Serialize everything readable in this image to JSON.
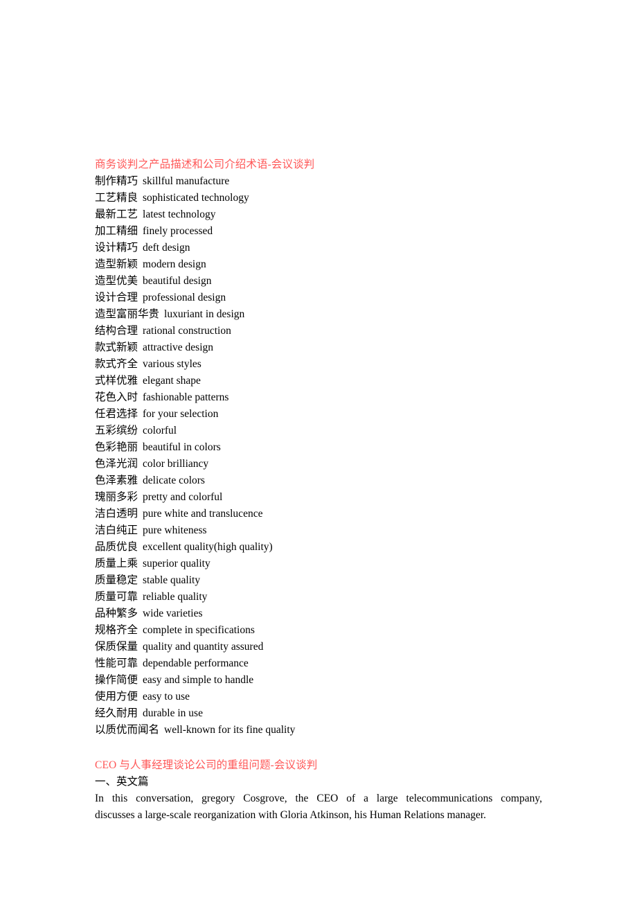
{
  "document": {
    "page_background": "#ffffff",
    "text_color": "#000000",
    "heading_color": "#ff5757"
  },
  "section1": {
    "title": "商务谈判之产品描述和公司介绍术语-会议谈判",
    "entries": [
      {
        "zh": "制作精巧",
        "en": "skillful manufacture"
      },
      {
        "zh": "工艺精良",
        "en": "sophisticated technology"
      },
      {
        "zh": "最新工艺",
        "en": "latest technology"
      },
      {
        "zh": "加工精细",
        "en": "finely processed"
      },
      {
        "zh": "设计精巧",
        "en": "deft design"
      },
      {
        "zh": "造型新颖",
        "en": "modern design"
      },
      {
        "zh": "造型优美",
        "en": "beautiful design"
      },
      {
        "zh": "设计合理",
        "en": "professional design"
      },
      {
        "zh": "造型富丽华贵",
        "en": "luxuriant in design"
      },
      {
        "zh": "结构合理",
        "en": "rational construction"
      },
      {
        "zh": "款式新颖",
        "en": "attractive design"
      },
      {
        "zh": "款式齐全",
        "en": "various styles"
      },
      {
        "zh": "式样优雅",
        "en": "elegant shape"
      },
      {
        "zh": "花色入时",
        "en": "fashionable patterns"
      },
      {
        "zh": "任君选择",
        "en": "for your selection"
      },
      {
        "zh": "五彩缤纷",
        "en": "colorful"
      },
      {
        "zh": "色彩艳丽",
        "en": "beautiful in colors"
      },
      {
        "zh": "色泽光润",
        "en": "color brilliancy"
      },
      {
        "zh": "色泽素雅",
        "en": "delicate colors"
      },
      {
        "zh": "瑰丽多彩",
        "en": "pretty and colorful"
      },
      {
        "zh": "洁白透明",
        "en": "pure white and translucence"
      },
      {
        "zh": "洁白纯正",
        "en": "pure whiteness"
      },
      {
        "zh": "品质优良",
        "en": "excellent quality(high quality)"
      },
      {
        "zh": "质量上乘",
        "en": "superior quality"
      },
      {
        "zh": "质量稳定",
        "en": "stable quality"
      },
      {
        "zh": "质量可靠",
        "en": "reliable quality"
      },
      {
        "zh": "品种繁多",
        "en": "wide varieties"
      },
      {
        "zh": "规格齐全",
        "en": "complete in specifications"
      },
      {
        "zh": "保质保量",
        "en": "quality and quantity assured"
      },
      {
        "zh": "性能可靠",
        "en": "dependable performance"
      },
      {
        "zh": "操作简便",
        "en": "easy and simple to handle"
      },
      {
        "zh": "使用方便",
        "en": "easy to use"
      },
      {
        "zh": "经久耐用",
        "en": "durable in use"
      },
      {
        "zh": "以质优而闻名",
        "en": "well-known for its fine quality"
      }
    ]
  },
  "section2": {
    "title": "CEO 与人事经理谈论公司的重组问题-会议谈判",
    "subheading": "一、英文篇",
    "paragraph_lines": [
      "In this conversation, gregory Cosgrove, the CEO of a large telecommunications company,",
      "discusses a large-scale reorganization with Gloria Atkinson, his Human Relations manager."
    ]
  }
}
